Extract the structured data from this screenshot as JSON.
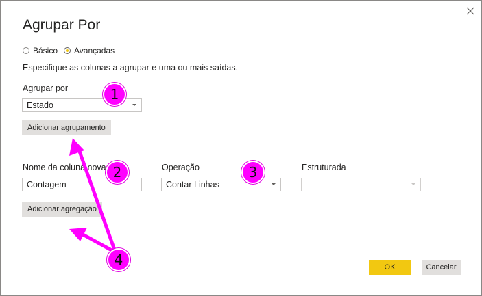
{
  "dialog": {
    "title": "Agrupar Por",
    "mode": {
      "basic_label": "Básico",
      "advanced_label": "Avançadas",
      "selected": "Avançadas"
    },
    "instruction": "Especifique as colunas a agrupar e uma ou mais saídas.",
    "group_by": {
      "label": "Agrupar por",
      "selected_column": "Estado",
      "add_grouping_label": "Adicionar agrupamento"
    },
    "aggregation": {
      "new_column_label": "Nome da coluna nova",
      "new_column_value": "Contagem",
      "operation_label": "Operação",
      "operation_value": "Contar Linhas",
      "structured_label": "Estruturada",
      "structured_value": "",
      "add_aggregation_label": "Adicionar agregação"
    },
    "footer": {
      "ok_label": "OK",
      "cancel_label": "Cancelar"
    }
  },
  "annotations": {
    "callout_color": "#ff00ff",
    "callouts": [
      "1",
      "2",
      "3",
      "4"
    ]
  },
  "theme": {
    "accent": "#f2c811",
    "button_gray": "#e1dfdd",
    "border": "#c8c6c4"
  }
}
